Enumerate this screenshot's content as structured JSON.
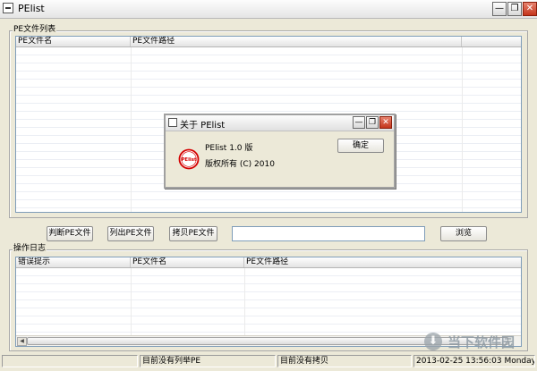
{
  "window": {
    "title": "PElist"
  },
  "window_controls": {
    "minimize": "—",
    "restore": "❐",
    "close": "✕"
  },
  "file_list_group": {
    "label": "PE文件列表",
    "columns": [
      "PE文件名",
      "PE文件路径"
    ]
  },
  "toolbar": {
    "judge_label": "判断PE文件",
    "list_label": "列出PE文件",
    "copy_label": "拷贝PE文件",
    "path_value": "",
    "browse_label": "浏览"
  },
  "log_group": {
    "label": "操作日志",
    "columns": [
      "错误提示",
      "PE文件名",
      "PE文件路径"
    ]
  },
  "statusbar": {
    "panel1": "",
    "panel2": "目前没有列举PE",
    "panel3": "目前没有拷贝",
    "panel4": "2013-02-25 13:56:03 Monday"
  },
  "watermark": {
    "text": "当下软件园",
    "icon": "download-icon"
  },
  "about_dialog": {
    "title": "关于 PElist",
    "version_line": "PElist 1.0 版",
    "copyright_line": "版权所有 (C) 2010",
    "ok_label": "确定",
    "logo_text": "PElist",
    "logo_color": "#d40000"
  }
}
